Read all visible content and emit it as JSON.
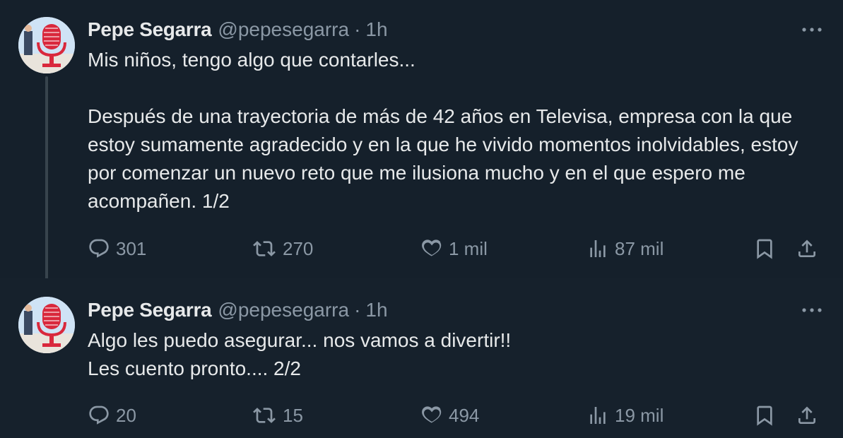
{
  "tweets": [
    {
      "author_name": "Pepe Segarra",
      "handle": "@pepesegarra",
      "separator": "·",
      "time": "1h",
      "text": "Mis niños, tengo algo que contarles...\n\nDespués de una trayectoria de más de 42 años en Televisa, empresa con la que estoy sumamente agradecido y en la que he vivido momentos inolvidables, estoy por comenzar un nuevo reto que me ilusiona mucho y en el que espero me acompañen. 1/2",
      "replies": "301",
      "retweets": "270",
      "likes": "1 mil",
      "views": "87 mil"
    },
    {
      "author_name": "Pepe Segarra",
      "handle": "@pepesegarra",
      "separator": "·",
      "time": "1h",
      "text": "Algo les puedo asegurar... nos vamos a divertir!!\nLes cuento pronto.... 2/2",
      "replies": "20",
      "retweets": "15",
      "likes": "494",
      "views": "19 mil"
    }
  ],
  "icons": {
    "more": "more-horizontal-icon",
    "reply": "reply-icon",
    "retweet": "retweet-icon",
    "like": "heart-icon",
    "views": "views-icon",
    "bookmark": "bookmark-icon",
    "share": "share-icon"
  },
  "colors": {
    "background": "#15202b",
    "text": "#e7e9ea",
    "muted": "#8b98a5",
    "thread_line": "#38444d"
  }
}
